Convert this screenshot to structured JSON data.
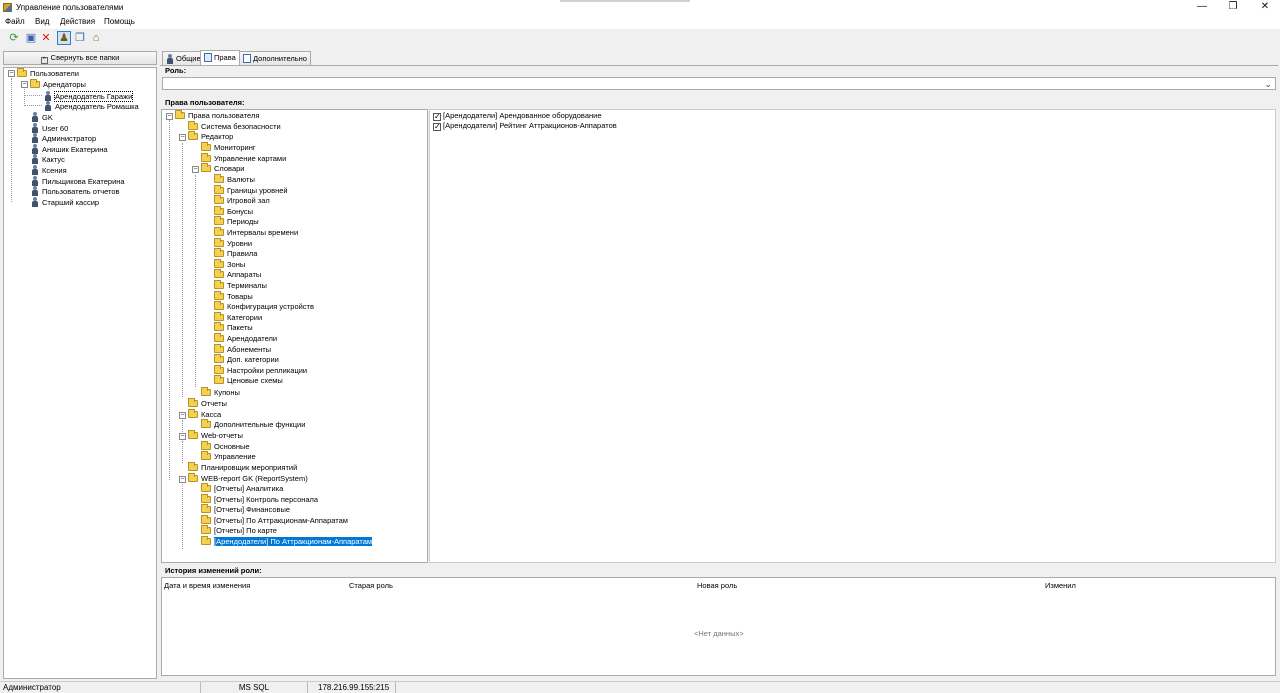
{
  "window": {
    "title": "Управление пользователями",
    "minimize": "—",
    "maximize": "❐",
    "close": "✕"
  },
  "menu": [
    "Файл",
    "Вид",
    "Действия",
    "Помощь"
  ],
  "toolbar": [
    {
      "icon": "refresh-icon"
    },
    {
      "icon": "save-icon"
    },
    {
      "icon": "delete-icon"
    },
    {
      "icon": "users-icon",
      "pressed": true
    },
    {
      "icon": "copy-icon"
    },
    {
      "icon": "tree-icon"
    }
  ],
  "left_panel": {
    "collapse_button": "Свернуть все папки",
    "root": "Пользователи",
    "group": "Арендаторы",
    "tenants": [
      "Арендодатель Гаражи",
      "Арендодатель Ромашка"
    ],
    "users": [
      "GK",
      "User 60",
      "Администратор",
      "Анишик Екатерина",
      "Кактус",
      "Ксения",
      "Пильщикова Екатерина",
      "Пользователь отчетов",
      "Старший кассир"
    ]
  },
  "tabs": [
    "Общие",
    "Права",
    "Дополнительно"
  ],
  "role": {
    "label": "Роль:",
    "value": ""
  },
  "rights": {
    "label": "Права пользователя:",
    "root": "Права пользователя",
    "security": "Система безопасности",
    "editor": "Редактор",
    "monitoring": "Мониторинг",
    "card_mgmt": "Управление картами",
    "dictionaries": "Словари",
    "dict_items": [
      "Валюты",
      "Границы уровней",
      "Игровой зал",
      "Бонусы",
      "Периоды",
      "Интервалы времени",
      "Уровни",
      "Правила",
      "Зоны",
      "Аппараты",
      "Терминалы",
      "Товары",
      "Конфигурация устройств",
      "Категории",
      "Пакеты",
      "Арендодатели",
      "Абонементы",
      "Доп. категории",
      "Настройки репликации",
      "Ценовые схемы"
    ],
    "coupons": "Купоны",
    "reports": "Отчеты",
    "cashier": "Касса",
    "extra_functions": "Дополнительные функции",
    "web_reports": "Web-отчеты",
    "web_items": [
      "Основные",
      "Управление"
    ],
    "scheduler": "Планировщик мероприятий",
    "web_report_gk": "WEB-report GK (ReportSystem)",
    "gk_items": [
      "[Отчеты] Аналитика",
      "[Отчеты] Контроль персонала",
      "[Отчеты] Финансовые",
      "[Отчеты]  По Аттракционам-Аппаратам",
      "[Отчеты] По карте",
      "[Арендодатели] По Аттракционам-Аппаратам"
    ]
  },
  "checked_rights": [
    "[Арендодатели] Арендованное оборудование",
    "[Арендодатели] Рейтинг Аттракционов-Аппаратов"
  ],
  "history": {
    "label": "История изменений роли:",
    "columns": [
      "Дата и время изменения",
      "Старая роль",
      "Новая роль",
      "Изменил"
    ],
    "empty": "<Нет данных>"
  },
  "status": {
    "user": "Администратор",
    "db": "MS SQL",
    "server": "178.216.99.155:215"
  }
}
